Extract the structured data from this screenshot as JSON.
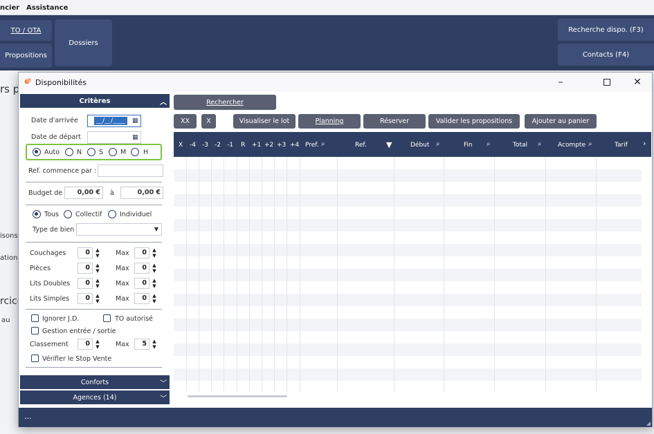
{
  "menu": {
    "item1": "ncier",
    "item2": "Assistance"
  },
  "toolbar": {
    "to_ota": "TO / OTA",
    "propositions": "Propositions",
    "dossiers": "Dossiers",
    "recherche_dispo": "Recherche dispo. (F3)",
    "contacts": "Contacts (F4)"
  },
  "background": {
    "frag1": "rs pa",
    "frag2": "isons",
    "frag3": "ations",
    "frag4": "rcice",
    "frag5": "au"
  },
  "dialog": {
    "title": "Disponibilités",
    "criteria_header": "Critères",
    "date_arrivee_label": "Date d'arrivée",
    "date_arrivee_value": "__/__/____",
    "date_depart_label": "Date de départ",
    "radio_type": [
      "Auto",
      "N",
      "S",
      "M",
      "H"
    ],
    "ref_label": "Ref. commence par :",
    "budget_label": "Budget de",
    "budget_from": "0,00 €",
    "budget_to_label": "à",
    "budget_to": "0,00 €",
    "radio_scope": [
      "Tous",
      "Collectif",
      "Individuel"
    ],
    "type_bien_label": "Type de bien",
    "couchages_label": "Couchages",
    "pieces_label": "Pièces",
    "lits_doubles_label": "Lits Doubles",
    "lits_simples_label": "Lits Simples",
    "max_label": "Max",
    "zero": "0",
    "ignorer_label": "Ignorer J.D.",
    "to_autorise_label": "TO autorisé",
    "gestion_label": "Gestion entrée / sortie",
    "classement_label": "Classement",
    "classement_max": "5",
    "stop_vente_label": "Vérifier le Stop Vente",
    "conforts": "Conforts",
    "agences": "Agences (14)",
    "status": "..."
  },
  "actions": {
    "rechercher": "Rechercher",
    "xx": "XX",
    "x": "X",
    "visualiser": "Visualiser le lot",
    "planning": "Planning",
    "reserver": "Réserver",
    "valider": "Valider les propositions",
    "ajouter": "Ajouter au panier"
  },
  "grid": {
    "columns": [
      "X",
      "-4",
      "-3",
      "-2",
      "-1",
      "R",
      "+1",
      "+2",
      "+3",
      "+4",
      "Pref.",
      "Ref.",
      "Début",
      "Fin",
      "Total",
      "Acompte",
      "Tarif"
    ]
  },
  "colors": {
    "navy": "#2f3f63",
    "highlight": "#7dc242",
    "button_gray": "#5a6072"
  }
}
